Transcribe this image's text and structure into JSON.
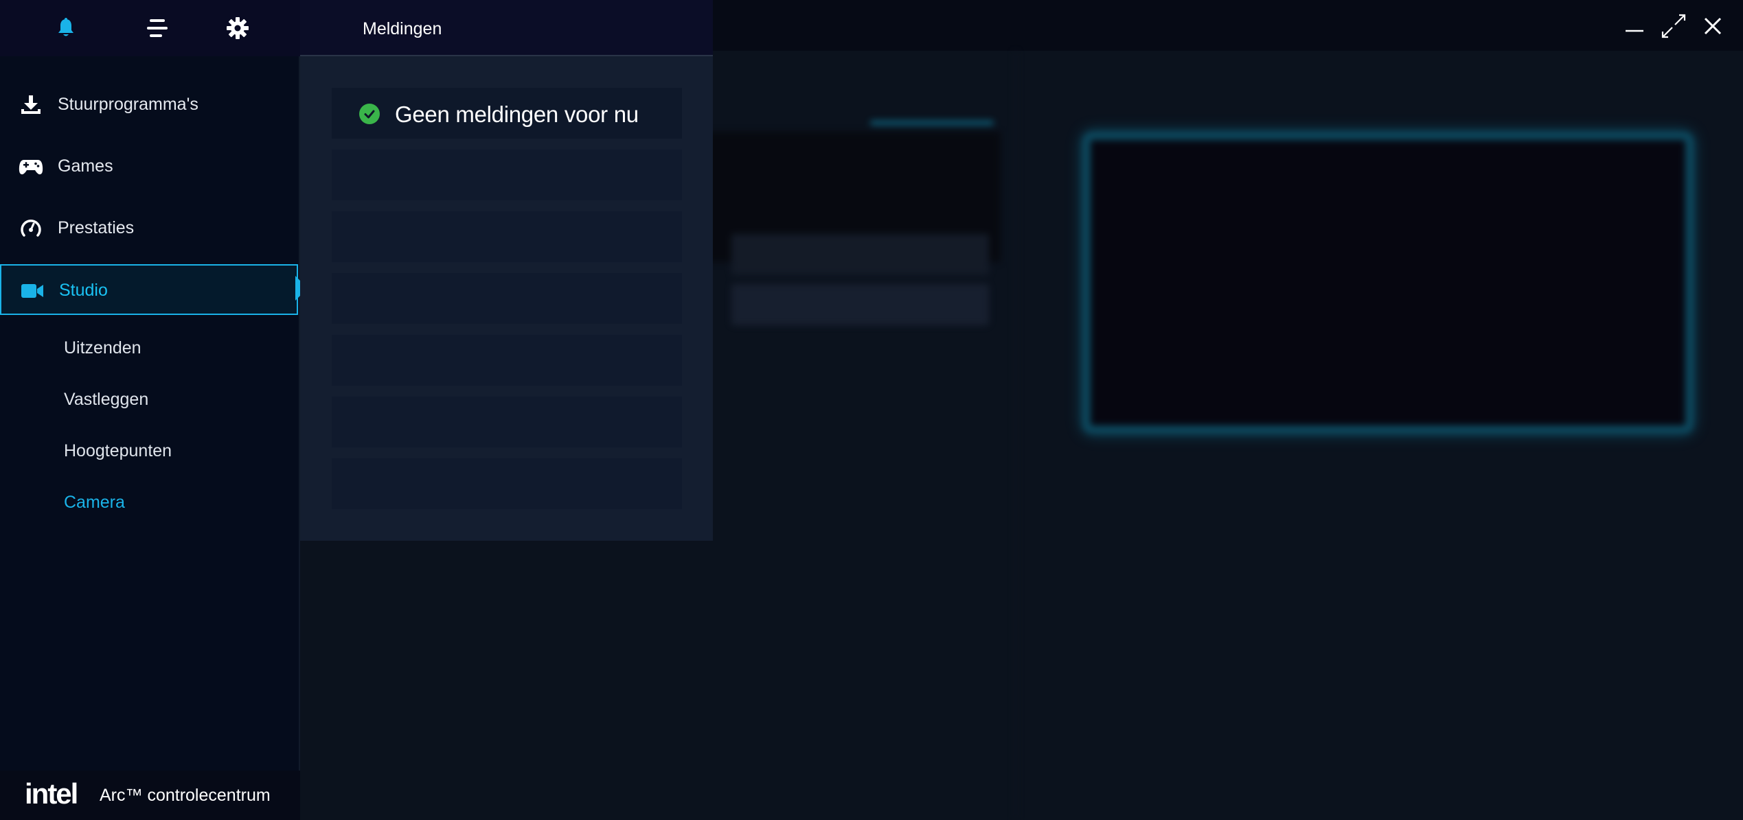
{
  "window": {
    "controls": {
      "minimize_icon": "minimize-icon",
      "maximize_icon": "maximize-icon",
      "close_icon": "close-icon"
    }
  },
  "sidebar": {
    "top_icons": [
      "bell-icon",
      "menu-icon",
      "gear-icon"
    ],
    "items": [
      {
        "label": "Stuurprogramma's",
        "icon": "download-icon"
      },
      {
        "label": "Games",
        "icon": "gamepad-icon"
      },
      {
        "label": "Prestaties",
        "icon": "gauge-icon"
      },
      {
        "label": "Studio",
        "icon": "camera-icon",
        "active": true
      }
    ],
    "subitems": [
      {
        "label": "Uitzenden"
      },
      {
        "label": "Vastleggen"
      },
      {
        "label": "Hoogtepunten"
      },
      {
        "label": "Camera",
        "active": true
      }
    ],
    "footer": {
      "logo": "intel",
      "title": "Arc™ controlecentrum"
    }
  },
  "notifications": {
    "title": "Meldingen",
    "empty_message": "Geen meldingen voor nu",
    "placeholder_rows": 6
  },
  "colors": {
    "accent": "#1ab3e8",
    "success": "#3ab54a",
    "sidebar_bg": "#050c1c",
    "panel_bg": "#141e30"
  }
}
